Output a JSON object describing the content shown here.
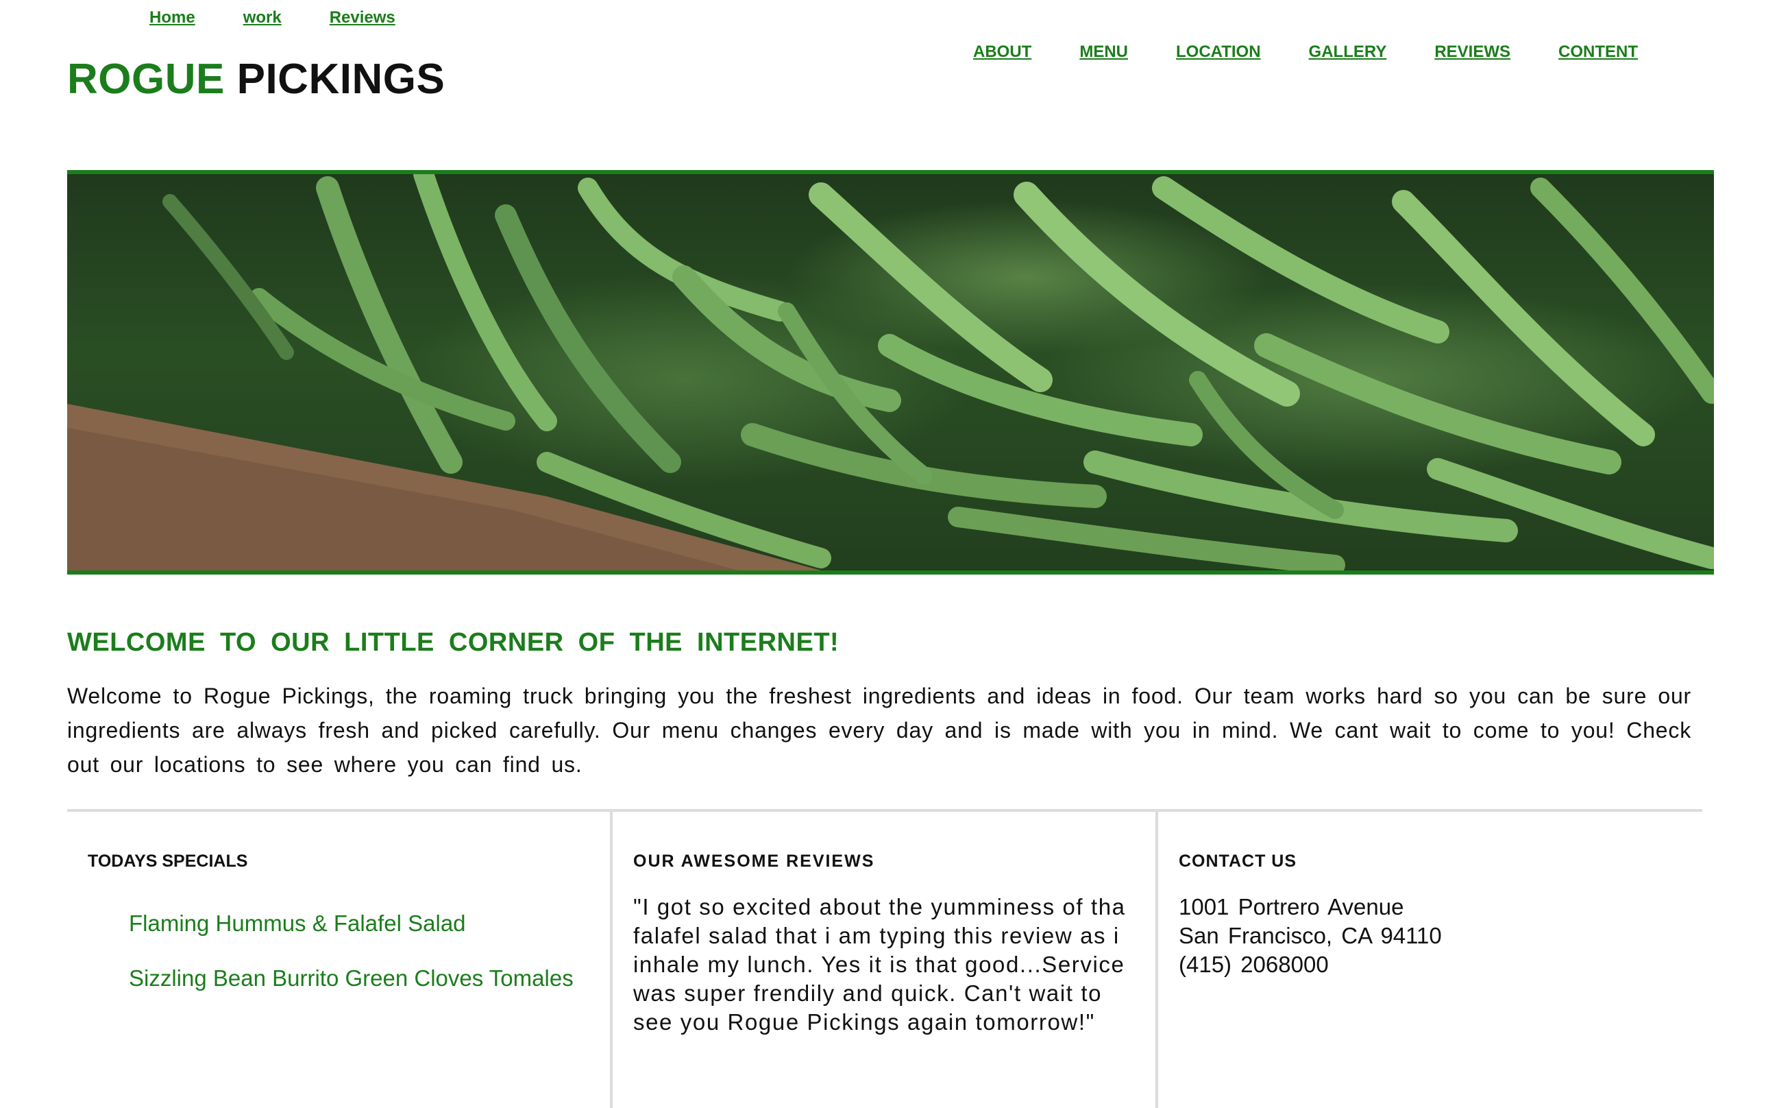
{
  "top_links": [
    "Home",
    "work",
    "Reviews"
  ],
  "logo": {
    "part1": "ROGUE",
    "part2": "PICKINGS"
  },
  "main_nav": [
    "ABOUT",
    "MENU",
    "LOCATION",
    "GALLERY",
    "REVIEWS",
    "CONTENT"
  ],
  "hero": {
    "description_icon": "green-beans-photo"
  },
  "welcome": {
    "title": "WELCOME TO OUR LITTLE CORNER OF THE INTERNET!",
    "text": "Welcome to Rogue Pickings, the roaming truck bringing you the freshest ingredients and ideas in food. Our team works hard so you can be sure our ingredients are always fresh and picked carefully. Our menu changes every day and is made with you in mind. We cant wait to come to you! Check out our locations to see where you can find us."
  },
  "specials": {
    "title": "TODAYS SPECIALS",
    "items": [
      "Flaming Hummus & Falafel Salad",
      "Sizzling Bean Burrito Green Cloves Tomales"
    ]
  },
  "reviews": {
    "title": "OUR AWESOME REVIEWS",
    "quote": "\"I got so excited about the yumminess of tha falafel salad that i am typing this review as i inhale my lunch. Yes it is that good...Service was super frendily and quick. Can't wait to see you Rogue Pickings again tomorrow!\""
  },
  "contact": {
    "title": "CONTACT US",
    "address_line1": "1001 Portrero Avenue",
    "address_line2": "San Francisco, CA 94110",
    "phone": "(415) 2068000"
  },
  "colors": {
    "accent": "#1b7d1b",
    "divider": "#dcdcdc",
    "text": "#111111"
  }
}
